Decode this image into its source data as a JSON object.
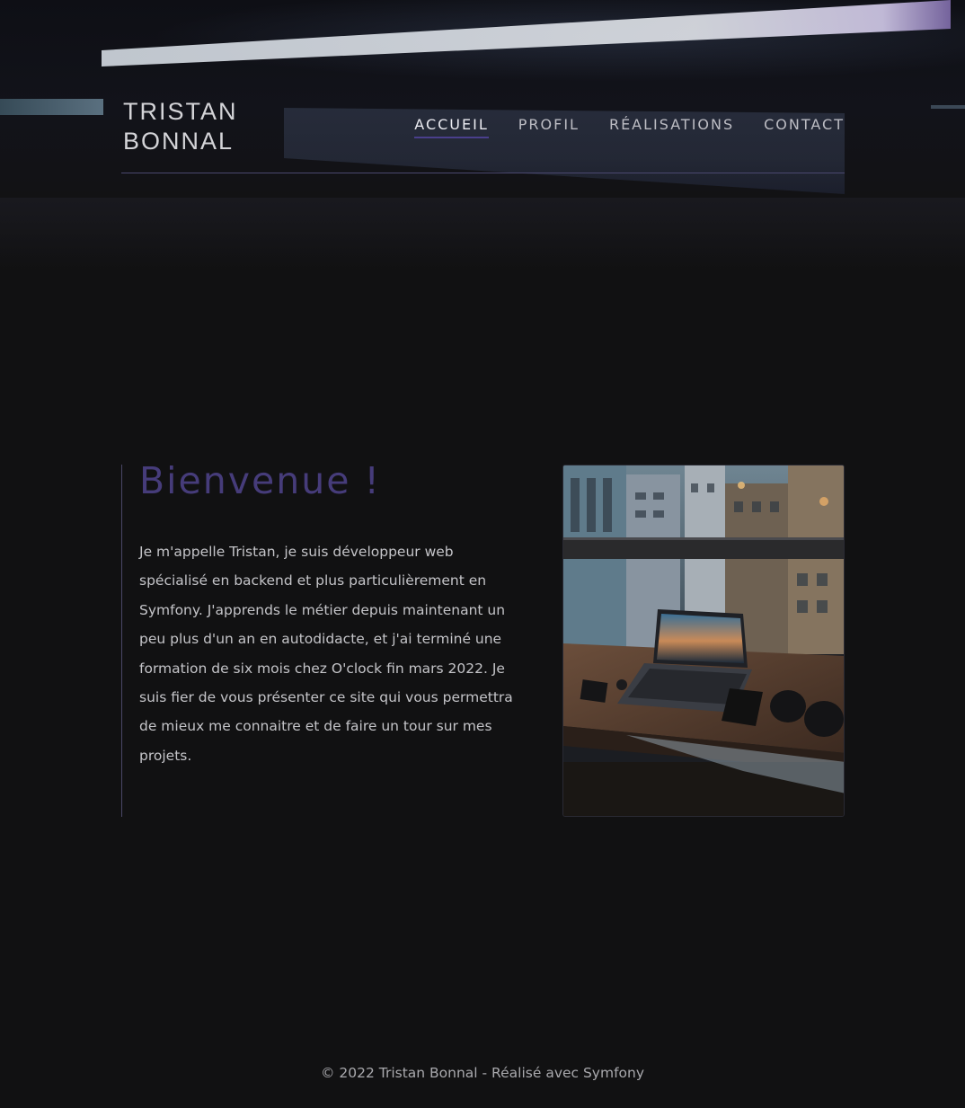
{
  "brand": {
    "line1": "TRISTAN",
    "line2": "BONNAL"
  },
  "nav": {
    "items": [
      {
        "label": "ACCUEIL",
        "active": true
      },
      {
        "label": "PROFIL",
        "active": false
      },
      {
        "label": "RÉALISATIONS",
        "active": false
      },
      {
        "label": "CONTACT",
        "active": false
      }
    ]
  },
  "intro": {
    "title": "Bienvenue !",
    "text": "Je m'appelle Tristan, je suis développeur web spécialisé en backend et plus particulièrement en Symfony. J'apprends le métier depuis maintenant un peu plus d'un an en autodidacte, et j'ai terminé une formation de six mois chez O'clock fin mars 2022. Je suis fier de vous présenter ce site qui vous permettra de mieux me connaitre et de faire un tour sur mes projets."
  },
  "photo": {
    "subject": "laptop on a desk by a window overlooking city buildings"
  },
  "footer": {
    "text": "© 2022 Tristan Bonnal - Réalisé avec Symfony"
  },
  "colors": {
    "background": "#111112",
    "accent": "#4a3f8c",
    "title": "#463c7a",
    "text": "#c4c4c8"
  }
}
